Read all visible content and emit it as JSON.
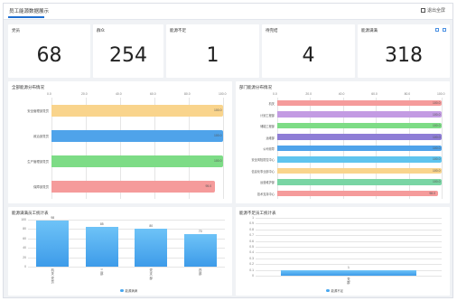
{
  "header": {
    "title": "员工能源数据展示",
    "fullscreen_label": "退出全屏"
  },
  "stats": [
    {
      "label": "党员",
      "value": "68"
    },
    {
      "label": "群众",
      "value": "254"
    },
    {
      "label": "能源不足",
      "value": "1"
    },
    {
      "label": "待完结",
      "value": "4"
    },
    {
      "label": "能源满满",
      "value": "318"
    }
  ],
  "charts": {
    "left_top": {
      "title": "全部能源分布情况",
      "ticks": [
        "0.0",
        "20.0",
        "40.0",
        "60.0",
        "80.0",
        "100.0"
      ]
    },
    "right_top": {
      "title": "部门能源分布情况",
      "ticks": [
        "0.0",
        "20.0",
        "40.0",
        "60.0",
        "80.0",
        "100.0"
      ]
    },
    "left_bottom": {
      "title": "能源满满员工统计表",
      "yticks": [
        "100",
        "80",
        "60",
        "40",
        "20",
        "0"
      ],
      "legend": "能源满满"
    },
    "right_bottom": {
      "title": "能源不足员工统计表",
      "yticks": [
        "1",
        "0.9",
        "0.8",
        "0.7",
        "0.6",
        "0.5",
        "0.4",
        "0.3",
        "0.2",
        "0.1",
        "0"
      ],
      "legend": "能源不足"
    }
  },
  "chart_data": [
    {
      "type": "bar",
      "orientation": "horizontal",
      "title": "全部能源分布情况",
      "categories": [
        "安全管理部党员",
        "政治部党员",
        "生产管理部党员",
        "保障部党员"
      ],
      "values": [
        100,
        100,
        100,
        95
      ],
      "colors": [
        "#f9d48c",
        "#4fa3ea",
        "#7ddc86",
        "#f59b9b"
      ],
      "xlim": [
        0,
        100
      ]
    },
    {
      "type": "bar",
      "orientation": "horizontal",
      "title": "部门能源分布情况",
      "categories": [
        "机关",
        "计划工程部",
        "储能工程部",
        "运维部",
        "公司领导",
        "安全风险防控中心",
        "信息化事业部中心",
        "运营维护部",
        "技术支持中心"
      ],
      "values": [
        100,
        100,
        100,
        100,
        100,
        100,
        100,
        100,
        98
      ],
      "colors": [
        "#f59b9b",
        "#c39be3",
        "#7ddc86",
        "#8e7dd6",
        "#4fa3ea",
        "#5fc4ee",
        "#f9d48c",
        "#79d5a4",
        "#f59b9b"
      ],
      "xlim": [
        0,
        100
      ]
    },
    {
      "type": "bar",
      "title": "能源满满员工统计表",
      "categories": [
        "机关党员",
        "三部",
        "党支部",
        "四部"
      ],
      "values": [
        98,
        85,
        80,
        70
      ],
      "ylim": [
        0,
        100
      ],
      "legend": [
        "能源满满"
      ]
    },
    {
      "type": "bar",
      "title": "能源不足员工统计表",
      "categories": [
        "党群"
      ],
      "values": [
        1
      ],
      "ylim": [
        0,
        1
      ],
      "legend": [
        "能源不足"
      ]
    }
  ]
}
